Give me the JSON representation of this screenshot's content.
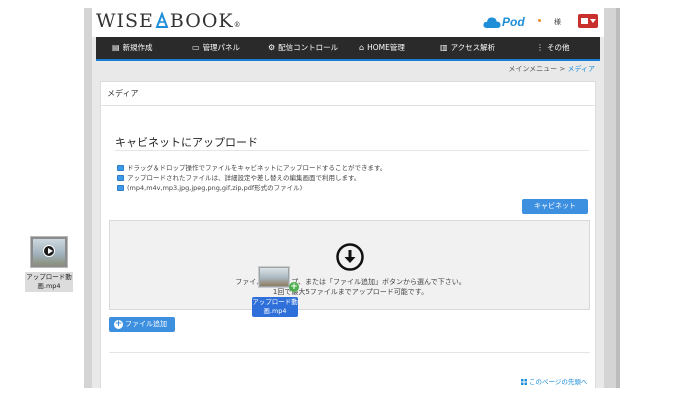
{
  "header": {
    "logo_text_left": "WISE",
    "logo_text_right": "BOOK",
    "logo_tm": "®",
    "pod_label": "Pod",
    "user_label": "様",
    "accent_blue": "#1e8ed8",
    "user_button_color": "#c9302c"
  },
  "nav": {
    "items": [
      {
        "icon": "new-document-icon",
        "label": "新規作成"
      },
      {
        "icon": "monitor-icon",
        "label": "管理パネル"
      },
      {
        "icon": "distribution-icon",
        "label": "配信コントロール"
      },
      {
        "icon": "home-icon",
        "label": "HOME管理"
      },
      {
        "icon": "chart-icon",
        "label": "アクセス解析"
      },
      {
        "icon": "more-icon",
        "label": "その他"
      }
    ]
  },
  "breadcrumb": {
    "parent": "メインメニュー",
    "separator": " > ",
    "current": "メディア"
  },
  "panel": {
    "title": "メディア",
    "section_title": "キャビネットにアップロード",
    "info_lines": [
      "ドラッグ＆ドロップ操作でファイルをキャビネットにアップロードすることができます。",
      "アップロードされたファイルは、詳細設定や差し替えの編集画面で利用します。",
      "(mp4,m4v,mp3,jpg,jpeg,png,gif,zip,pdf形式のファイル)"
    ],
    "cabinet_button": "キャビネット",
    "dropzone_line1": "ファイルをドロップ、または「ファイル追加」ボタンから選んで下さい。",
    "dropzone_line2": "1回で最大5ファイルまでアップロード可能です。",
    "add_file_button": "ファイル追加",
    "page_top_link": "このページの先頭へ"
  },
  "desktop": {
    "file_name": "アップロード動画.mp4"
  },
  "drag": {
    "file_name": "アップロード動画.mp4"
  }
}
